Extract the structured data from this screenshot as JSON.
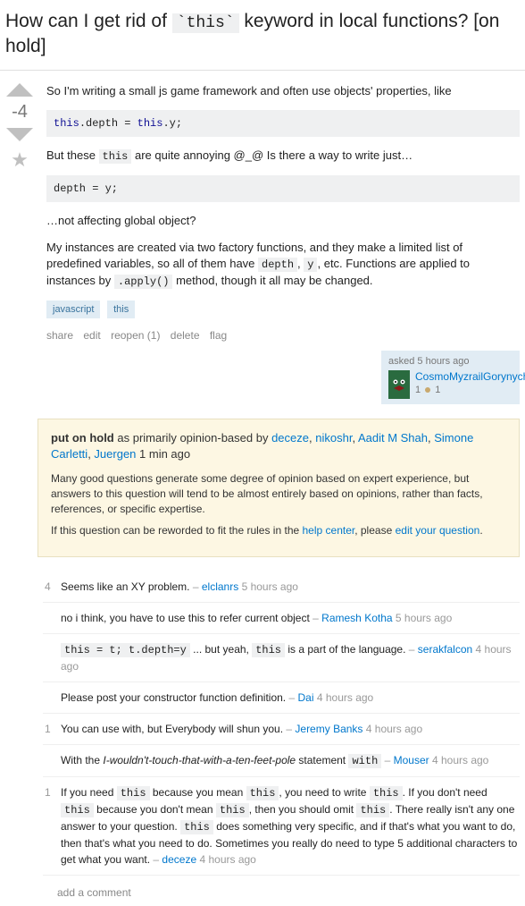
{
  "title_pre": "How can I get rid of ",
  "title_code": "`this`",
  "title_post": " keyword in local functions? [on hold]",
  "score": "-4",
  "p1": "So I'm writing a small js game framework and often use objects' properties, like",
  "code1_a": "this",
  "code1_b": ".depth = ",
  "code1_c": "this",
  "code1_d": ".y;",
  "p2_a": "But these ",
  "p2_code": "this",
  "p2_b": " are quite annoying @_@ Is there a way to write just…",
  "code2": "depth = y;",
  "p3": "…not affecting global object?",
  "p4_a": "My instances are created via two factory functions, and they make a limited list of predefined variables, so all of them have ",
  "p4_c1": "depth",
  "p4_m": ", ",
  "p4_c2": "y",
  "p4_b": ", etc. Functions are applied to instances by ",
  "p4_c3": ".apply()",
  "p4_c": " method, though it all may be changed.",
  "tags": [
    "javascript",
    "this"
  ],
  "actions": {
    "share": "share",
    "edit": "edit",
    "reopen": "reopen (1)",
    "delete": "delete",
    "flag": "flag"
  },
  "usercard": {
    "when": "asked 5 hours ago",
    "name": "CosmoMyzrailGorynych",
    "rep": "1"
  },
  "notice": {
    "hold_b": "put on hold",
    "hold_a": " as primarily opinion-based by ",
    "closers": [
      "deceze",
      "nikoshr",
      "Aadit M Shah",
      "Simone Carletti",
      "Juergen"
    ],
    "when": " 1 min ago",
    "p1": "Many good questions generate some degree of opinion based on expert experience, but answers to this question will tend to be almost entirely based on opinions, rather than facts, references, or specific expertise.",
    "p2_a": "If this question can be reworded to fit the rules in the ",
    "p2_l1": "help center",
    "p2_b": ", please ",
    "p2_l2": "edit your question",
    "p2_c": "."
  },
  "comments": [
    {
      "v": "4",
      "pre": "Seems like an XY problem. ",
      "dash": "– ",
      "user": "elclanrs",
      "time": " 5 hours ago"
    },
    {
      "v": "",
      "pre": "no i think, you have to use this to refer current object ",
      "dash": "–  ",
      "user": "Ramesh Kotha",
      "time": " 5 hours ago"
    },
    {
      "v": "",
      "c1": "this = t; t.depth=y",
      "mid": " ... but yeah, ",
      "c2": "this",
      "post": " is a part of the language. ",
      "dash": "–  ",
      "user": "serakfalcon",
      "time": " 4 hours ago"
    },
    {
      "v": "",
      "pre": "Please post your constructor function definition. ",
      "dash": "–  ",
      "user": "Dai",
      "time": " 4 hours ago"
    },
    {
      "v": "1",
      "pre": "You can use with, but Everybody will shun you. ",
      "dash": "–  ",
      "user": "Jeremy Banks",
      "time": " 4 hours ago"
    },
    {
      "v": "",
      "pre": "With the ",
      "em": "I-wouldn't-touch-that-with-a-ten-feet-pole",
      "mid2": " statement ",
      "c1": "with",
      "dash": " –  ",
      "user": "Mouser",
      "time": " 4 hours ago"
    },
    {
      "v": "1",
      "pre": "If you need ",
      "c1": "this",
      "m1": " because you mean ",
      "c2": "this",
      "m2": ", you need to write ",
      "c3": "this",
      "m3": ". If you don't need ",
      "c4": "this",
      "m4": " because you don't mean ",
      "c5": "this",
      "m5": ", then you should omit ",
      "c6": "this",
      "m6": ". There really isn't any one answer to your question. ",
      "c7": "this",
      "m7": " does something very specific, and if that's what you want to do, then that's what you need to do. Sometimes you really do need to type 5 additional characters to get what you want. ",
      "dash": "–  ",
      "user": "deceze",
      "time": " 4 hours ago"
    }
  ],
  "addcomment": "add a comment"
}
